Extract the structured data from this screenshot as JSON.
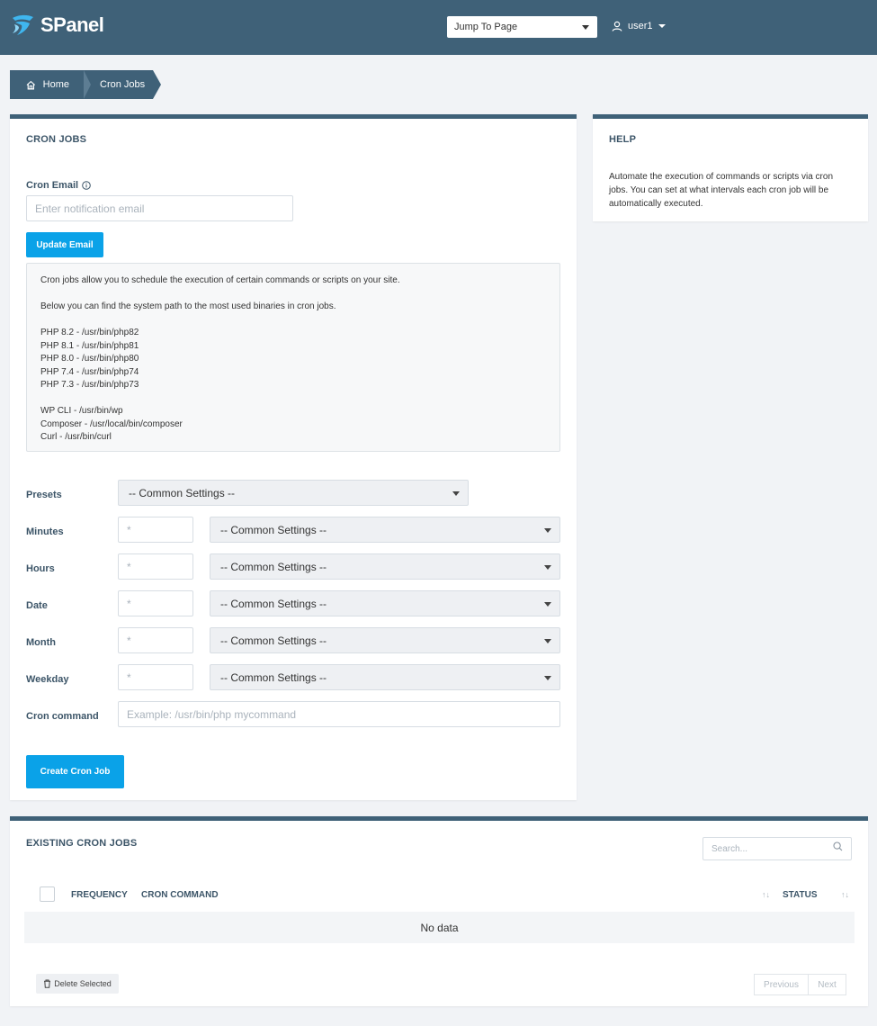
{
  "header": {
    "logo_text": "SPanel",
    "jump_to_page": "Jump To Page",
    "username": "user1"
  },
  "breadcrumb": {
    "home": "Home",
    "current": "Cron Jobs"
  },
  "cron_jobs_card": {
    "title": "CRON JOBS",
    "email_label": "Cron Email",
    "email_placeholder": "Enter notification email",
    "update_email_button": "Update Email",
    "info_lines": [
      "Cron jobs allow you to schedule the execution of certain commands or scripts on your site.",
      "",
      "Below you can find the system path to the most used binaries in cron jobs.",
      "",
      "PHP 8.2 - /usr/bin/php82",
      "PHP 8.1 - /usr/bin/php81",
      "PHP 8.0 - /usr/bin/php80",
      "PHP 7.4 - /usr/bin/php74",
      "PHP 7.3 - /usr/bin/php73",
      "",
      "WP CLI - /usr/bin/wp",
      "Composer - /usr/local/bin/composer",
      "Curl - /usr/bin/curl"
    ],
    "presets_label": "Presets",
    "common_settings": "-- Common Settings --",
    "fields": [
      {
        "label": "Minutes",
        "value": "*",
        "select": "-- Common Settings --"
      },
      {
        "label": "Hours",
        "value": "*",
        "select": "-- Common Settings --"
      },
      {
        "label": "Date",
        "value": "*",
        "select": "-- Common Settings --"
      },
      {
        "label": "Month",
        "value": "*",
        "select": "-- Common Settings --"
      },
      {
        "label": "Weekday",
        "value": "*",
        "select": "-- Common Settings --"
      }
    ],
    "command_label": "Cron command",
    "command_placeholder": "Example: /usr/bin/php mycommand",
    "create_button": "Create Cron Job"
  },
  "help_card": {
    "title": "HELP",
    "text": "Automate the execution of commands or scripts via cron jobs. You can set at what intervals each cron job will be automatically executed."
  },
  "existing_card": {
    "title": "EXISTING CRON JOBS",
    "search_placeholder": "Search...",
    "columns": [
      "FREQUENCY",
      "CRON COMMAND",
      "STATUS"
    ],
    "empty_text": "No data",
    "delete_button": "Delete Selected",
    "previous": "Previous",
    "next": "Next"
  },
  "colors": {
    "header_bg": "#3f6178",
    "accent_blue": "#0aa2e8",
    "page_bg": "#f1f3f6"
  }
}
